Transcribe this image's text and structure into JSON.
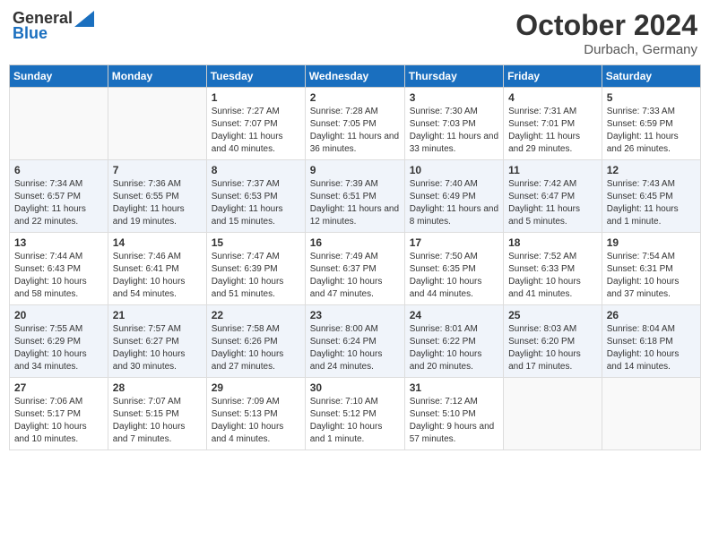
{
  "header": {
    "logo_general": "General",
    "logo_blue": "Blue",
    "month": "October 2024",
    "location": "Durbach, Germany"
  },
  "days_of_week": [
    "Sunday",
    "Monday",
    "Tuesday",
    "Wednesday",
    "Thursday",
    "Friday",
    "Saturday"
  ],
  "weeks": [
    [
      {
        "day": "",
        "sunrise": "",
        "sunset": "",
        "daylight": ""
      },
      {
        "day": "",
        "sunrise": "",
        "sunset": "",
        "daylight": ""
      },
      {
        "day": "1",
        "sunrise": "Sunrise: 7:27 AM",
        "sunset": "Sunset: 7:07 PM",
        "daylight": "Daylight: 11 hours and 40 minutes."
      },
      {
        "day": "2",
        "sunrise": "Sunrise: 7:28 AM",
        "sunset": "Sunset: 7:05 PM",
        "daylight": "Daylight: 11 hours and 36 minutes."
      },
      {
        "day": "3",
        "sunrise": "Sunrise: 7:30 AM",
        "sunset": "Sunset: 7:03 PM",
        "daylight": "Daylight: 11 hours and 33 minutes."
      },
      {
        "day": "4",
        "sunrise": "Sunrise: 7:31 AM",
        "sunset": "Sunset: 7:01 PM",
        "daylight": "Daylight: 11 hours and 29 minutes."
      },
      {
        "day": "5",
        "sunrise": "Sunrise: 7:33 AM",
        "sunset": "Sunset: 6:59 PM",
        "daylight": "Daylight: 11 hours and 26 minutes."
      }
    ],
    [
      {
        "day": "6",
        "sunrise": "Sunrise: 7:34 AM",
        "sunset": "Sunset: 6:57 PM",
        "daylight": "Daylight: 11 hours and 22 minutes."
      },
      {
        "day": "7",
        "sunrise": "Sunrise: 7:36 AM",
        "sunset": "Sunset: 6:55 PM",
        "daylight": "Daylight: 11 hours and 19 minutes."
      },
      {
        "day": "8",
        "sunrise": "Sunrise: 7:37 AM",
        "sunset": "Sunset: 6:53 PM",
        "daylight": "Daylight: 11 hours and 15 minutes."
      },
      {
        "day": "9",
        "sunrise": "Sunrise: 7:39 AM",
        "sunset": "Sunset: 6:51 PM",
        "daylight": "Daylight: 11 hours and 12 minutes."
      },
      {
        "day": "10",
        "sunrise": "Sunrise: 7:40 AM",
        "sunset": "Sunset: 6:49 PM",
        "daylight": "Daylight: 11 hours and 8 minutes."
      },
      {
        "day": "11",
        "sunrise": "Sunrise: 7:42 AM",
        "sunset": "Sunset: 6:47 PM",
        "daylight": "Daylight: 11 hours and 5 minutes."
      },
      {
        "day": "12",
        "sunrise": "Sunrise: 7:43 AM",
        "sunset": "Sunset: 6:45 PM",
        "daylight": "Daylight: 11 hours and 1 minute."
      }
    ],
    [
      {
        "day": "13",
        "sunrise": "Sunrise: 7:44 AM",
        "sunset": "Sunset: 6:43 PM",
        "daylight": "Daylight: 10 hours and 58 minutes."
      },
      {
        "day": "14",
        "sunrise": "Sunrise: 7:46 AM",
        "sunset": "Sunset: 6:41 PM",
        "daylight": "Daylight: 10 hours and 54 minutes."
      },
      {
        "day": "15",
        "sunrise": "Sunrise: 7:47 AM",
        "sunset": "Sunset: 6:39 PM",
        "daylight": "Daylight: 10 hours and 51 minutes."
      },
      {
        "day": "16",
        "sunrise": "Sunrise: 7:49 AM",
        "sunset": "Sunset: 6:37 PM",
        "daylight": "Daylight: 10 hours and 47 minutes."
      },
      {
        "day": "17",
        "sunrise": "Sunrise: 7:50 AM",
        "sunset": "Sunset: 6:35 PM",
        "daylight": "Daylight: 10 hours and 44 minutes."
      },
      {
        "day": "18",
        "sunrise": "Sunrise: 7:52 AM",
        "sunset": "Sunset: 6:33 PM",
        "daylight": "Daylight: 10 hours and 41 minutes."
      },
      {
        "day": "19",
        "sunrise": "Sunrise: 7:54 AM",
        "sunset": "Sunset: 6:31 PM",
        "daylight": "Daylight: 10 hours and 37 minutes."
      }
    ],
    [
      {
        "day": "20",
        "sunrise": "Sunrise: 7:55 AM",
        "sunset": "Sunset: 6:29 PM",
        "daylight": "Daylight: 10 hours and 34 minutes."
      },
      {
        "day": "21",
        "sunrise": "Sunrise: 7:57 AM",
        "sunset": "Sunset: 6:27 PM",
        "daylight": "Daylight: 10 hours and 30 minutes."
      },
      {
        "day": "22",
        "sunrise": "Sunrise: 7:58 AM",
        "sunset": "Sunset: 6:26 PM",
        "daylight": "Daylight: 10 hours and 27 minutes."
      },
      {
        "day": "23",
        "sunrise": "Sunrise: 8:00 AM",
        "sunset": "Sunset: 6:24 PM",
        "daylight": "Daylight: 10 hours and 24 minutes."
      },
      {
        "day": "24",
        "sunrise": "Sunrise: 8:01 AM",
        "sunset": "Sunset: 6:22 PM",
        "daylight": "Daylight: 10 hours and 20 minutes."
      },
      {
        "day": "25",
        "sunrise": "Sunrise: 8:03 AM",
        "sunset": "Sunset: 6:20 PM",
        "daylight": "Daylight: 10 hours and 17 minutes."
      },
      {
        "day": "26",
        "sunrise": "Sunrise: 8:04 AM",
        "sunset": "Sunset: 6:18 PM",
        "daylight": "Daylight: 10 hours and 14 minutes."
      }
    ],
    [
      {
        "day": "27",
        "sunrise": "Sunrise: 7:06 AM",
        "sunset": "Sunset: 5:17 PM",
        "daylight": "Daylight: 10 hours and 10 minutes."
      },
      {
        "day": "28",
        "sunrise": "Sunrise: 7:07 AM",
        "sunset": "Sunset: 5:15 PM",
        "daylight": "Daylight: 10 hours and 7 minutes."
      },
      {
        "day": "29",
        "sunrise": "Sunrise: 7:09 AM",
        "sunset": "Sunset: 5:13 PM",
        "daylight": "Daylight: 10 hours and 4 minutes."
      },
      {
        "day": "30",
        "sunrise": "Sunrise: 7:10 AM",
        "sunset": "Sunset: 5:12 PM",
        "daylight": "Daylight: 10 hours and 1 minute."
      },
      {
        "day": "31",
        "sunrise": "Sunrise: 7:12 AM",
        "sunset": "Sunset: 5:10 PM",
        "daylight": "Daylight: 9 hours and 57 minutes."
      },
      {
        "day": "",
        "sunrise": "",
        "sunset": "",
        "daylight": ""
      },
      {
        "day": "",
        "sunrise": "",
        "sunset": "",
        "daylight": ""
      }
    ]
  ]
}
